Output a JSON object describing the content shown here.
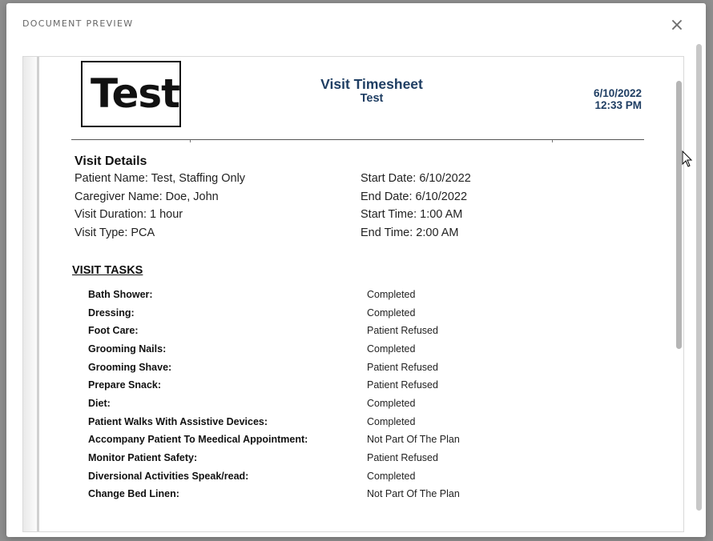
{
  "modal": {
    "title": "DOCUMENT PREVIEW",
    "close_icon": "close-icon"
  },
  "document": {
    "logo_text": "Test",
    "title": "Visit Timesheet",
    "subtitle": "Test",
    "date": "6/10/2022",
    "time": "12:33 PM",
    "details_heading": "Visit Details",
    "details_left": [
      "Patient Name: Test, Staffing Only",
      "Caregiver Name: Doe, John",
      "Visit Duration: 1 hour",
      "Visit Type: PCA"
    ],
    "details_right": [
      "Start Date: 6/10/2022",
      "End Date: 6/10/2022",
      "Start Time: 1:00 AM",
      "End Time: 2:00 AM"
    ],
    "tasks_heading": "VISIT TASKS",
    "tasks": [
      {
        "name": "Bath Shower:",
        "status": "Completed"
      },
      {
        "name": "Dressing:",
        "status": "Completed"
      },
      {
        "name": "Foot Care:",
        "status": "Patient Refused"
      },
      {
        "name": "Grooming Nails:",
        "status": "Completed"
      },
      {
        "name": "Grooming Shave:",
        "status": "Patient Refused"
      },
      {
        "name": "Prepare Snack:",
        "status": "Patient Refused"
      },
      {
        "name": "Diet:",
        "status": "Completed"
      },
      {
        "name": "Patient Walks With Assistive Devices:",
        "status": "Completed"
      },
      {
        "name": "Accompany Patient To Meedical Appointment:",
        "status": "Not Part Of The Plan"
      },
      {
        "name": "Monitor Patient Safety:",
        "status": "Patient Refused"
      },
      {
        "name": "Diversional Activities Speak/read:",
        "status": "Completed"
      },
      {
        "name": "Change Bed Linen:",
        "status": "Not Part Of The Plan"
      }
    ]
  },
  "colors": {
    "title_blue": "#1f3e63",
    "overlay": "#8f8f8f"
  }
}
